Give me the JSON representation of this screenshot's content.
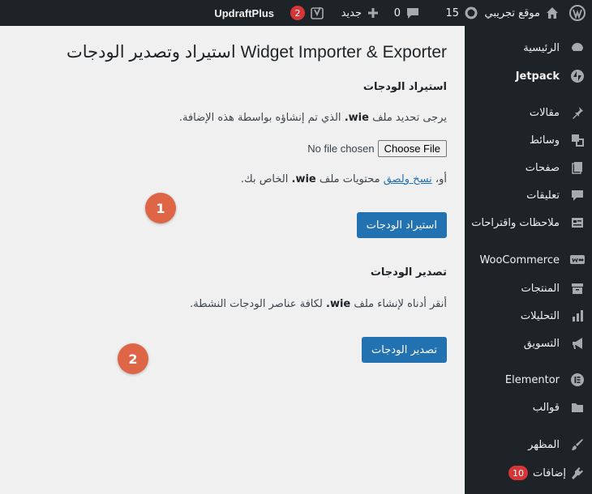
{
  "adminbar": {
    "site_name": "موقع تجريبي",
    "updates_count": "15",
    "comments_count": "0",
    "new_label": "جديد",
    "yoast_count": "2",
    "updraft_label": "UpdraftPlus"
  },
  "sidebar": {
    "items": [
      {
        "label": "الرئيسية",
        "icon": "dashboard-icon"
      },
      {
        "label": "Jetpack",
        "icon": "jetpack-icon"
      },
      {
        "label": "مقالات",
        "icon": "pin-icon"
      },
      {
        "label": "وسائط",
        "icon": "media-icon"
      },
      {
        "label": "صفحات",
        "icon": "pages-icon"
      },
      {
        "label": "تعليقات",
        "icon": "comment-icon"
      },
      {
        "label": "ملاحظات واقتراحات",
        "icon": "feedback-icon"
      },
      {
        "label": "WooCommerce",
        "icon": "woo-icon"
      },
      {
        "label": "المنتجات",
        "icon": "archive-icon"
      },
      {
        "label": "التحليلات",
        "icon": "bar-chart-icon"
      },
      {
        "label": "التسويق",
        "icon": "megaphone-icon"
      },
      {
        "label": "Elementor",
        "icon": "elementor-icon"
      },
      {
        "label": "قوالب",
        "icon": "folder-icon"
      },
      {
        "label": "المظهر",
        "icon": "brush-icon"
      },
      {
        "label": "إضافات",
        "icon": "plugin-icon",
        "badge": "10"
      }
    ]
  },
  "main": {
    "title": "Widget Importer & Exporter استيراد وتصدير الودجات",
    "import": {
      "heading": "استيراد الودجات",
      "instruction_pre": "يرجى تحديد ملف ",
      "file_ext": "wie.",
      "instruction_post": " الذي تم إنشاؤه بواسطة هذه الإضافة.",
      "choose_file": "Choose File",
      "no_file": "No file chosen",
      "or_label": "أو، ",
      "paste_link": "نسخ ولصق",
      "paste_mid": " محتويات ملف ",
      "paste_post": " الخاص بك.",
      "button": "استيراد الودجات"
    },
    "export": {
      "heading": "تصدير الودجات",
      "instruction_pre": "أنقر أدناه لإنشاء ملف ",
      "file_ext": "wie.",
      "instruction_post": " لكافة عناصر الودجات النشطة.",
      "button": "تصدير الودجات"
    },
    "markers": [
      "1",
      "2"
    ]
  },
  "colors": {
    "accent": "#2271b1",
    "marker": "#de6546",
    "sidebar_bg": "#1d2327",
    "badge": "#d63638"
  }
}
